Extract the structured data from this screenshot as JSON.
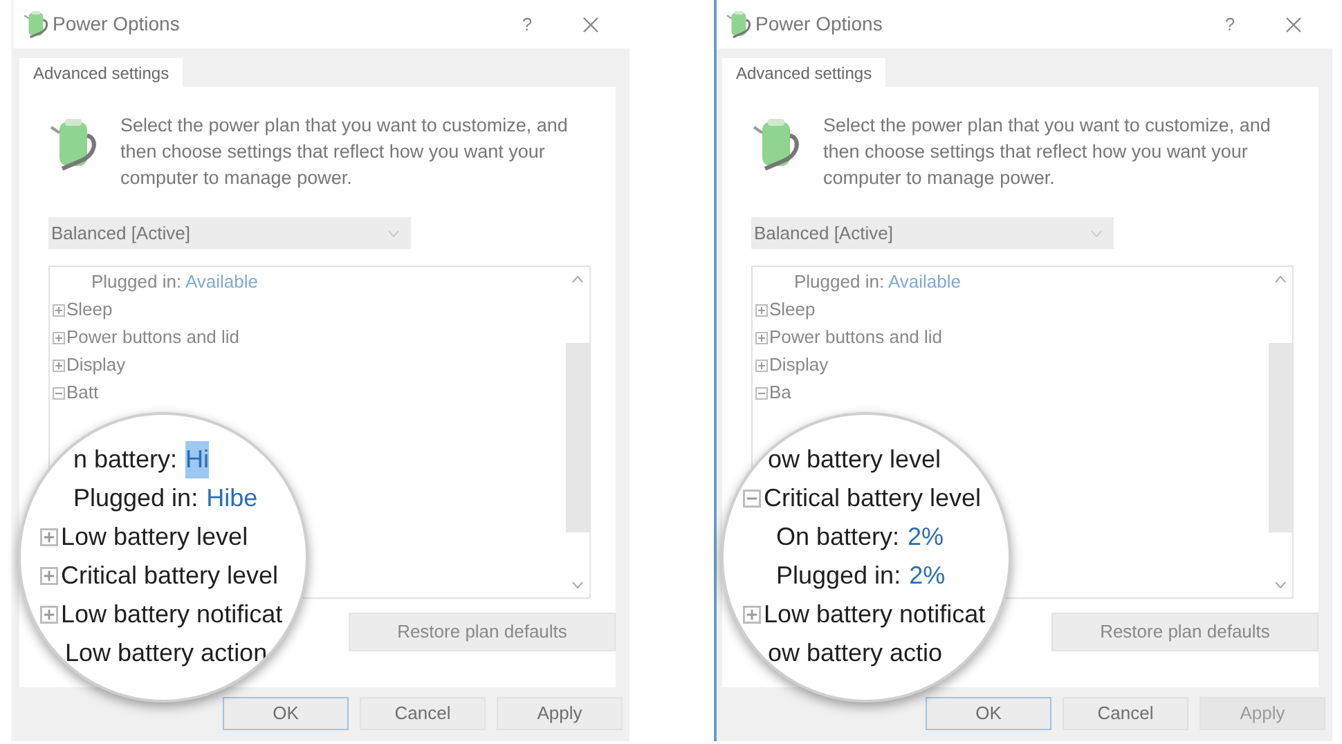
{
  "dialogs": [
    {
      "active": false,
      "title": "Power Options",
      "help": "?",
      "tab": {
        "label": "Advanced settings",
        "selected": true
      },
      "description": "Select the power plan that you want to customize, and then choose settings that reflect how you want your computer to manage power.",
      "plan": "Balanced [Active]",
      "tree": [
        {
          "kind": "setting",
          "label": "Plugged in:",
          "value": "Available"
        },
        {
          "kind": "group",
          "label": "Sleep",
          "expanded": false
        },
        {
          "kind": "group",
          "label": "Power buttons and lid",
          "expanded": false
        },
        {
          "kind": "group",
          "label": "Display",
          "expanded": false
        },
        {
          "kind": "group",
          "label": "Batt",
          "expanded": true
        }
      ],
      "magnifier": [
        {
          "kind": "setting",
          "label": "n battery:",
          "value": "Hi",
          "selected": true
        },
        {
          "kind": "setting",
          "label": "Plugged in:",
          "value": "Hibe",
          "selected": false
        },
        {
          "kind": "group",
          "label": "Low battery level",
          "expanded": false
        },
        {
          "kind": "group",
          "label": "Critical battery level",
          "expanded": false
        },
        {
          "kind": "group",
          "label": "Low battery notificat",
          "expanded": false
        },
        {
          "kind": "group",
          "label": "Low battery action"
        }
      ],
      "restore": "Restore plan defaults",
      "buttons": [
        {
          "label": "OK",
          "default": true,
          "disabled": false
        },
        {
          "label": "Cancel",
          "default": false,
          "disabled": false
        },
        {
          "label": "Apply",
          "default": false,
          "disabled": false
        }
      ]
    },
    {
      "active": true,
      "title": "Power Options",
      "help": "?",
      "tab": {
        "label": "Advanced settings",
        "selected": true
      },
      "description": "Select the power plan that you want to customize, and then choose settings that reflect how you want your computer to manage power.",
      "plan": "Balanced [Active]",
      "tree": [
        {
          "kind": "setting",
          "label": "Plugged in:",
          "value": "Available"
        },
        {
          "kind": "group",
          "label": "Sleep",
          "expanded": false
        },
        {
          "kind": "group",
          "label": "Power buttons and lid",
          "expanded": false
        },
        {
          "kind": "group",
          "label": "Display",
          "expanded": false
        },
        {
          "kind": "group",
          "label": "Ba",
          "expanded": true
        }
      ],
      "magnifier": [
        {
          "kind": "group",
          "label": "ow battery level"
        },
        {
          "kind": "group",
          "label": "Critical battery level",
          "expanded": true
        },
        {
          "kind": "setting",
          "label": "On battery:",
          "value": "2%",
          "selected": false
        },
        {
          "kind": "setting",
          "label": "Plugged in:",
          "value": "2%",
          "selected": false
        },
        {
          "kind": "group",
          "label": "Low battery notificat",
          "expanded": false
        },
        {
          "kind": "group",
          "label": "ow battery actio"
        }
      ],
      "restore": "Restore plan defaults",
      "buttons": [
        {
          "label": "OK",
          "default": true,
          "disabled": false
        },
        {
          "label": "Cancel",
          "default": false,
          "disabled": false
        },
        {
          "label": "Apply",
          "default": false,
          "disabled": true
        }
      ]
    }
  ]
}
